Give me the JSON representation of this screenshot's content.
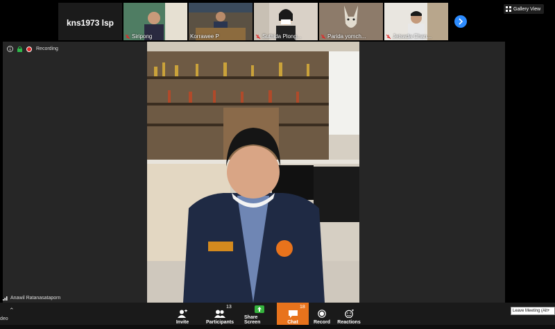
{
  "thumbnails": [
    {
      "name": "",
      "label": "kns1973 lsp",
      "kind": "text"
    },
    {
      "name": "Siripong",
      "bg": "#5a8c6e"
    },
    {
      "name": "Korrawee P",
      "bg": "#6b6154"
    },
    {
      "name": "Suthida Plong...",
      "bg": "#d9d1c7"
    },
    {
      "name": "Parida yomch...",
      "bg": "#8d7b6a"
    },
    {
      "name": "Jetsada Chan...",
      "bg": "#7a6c5c"
    }
  ],
  "gallery_view_label": "Gallery View",
  "recording_label": "Recording",
  "speaker_name": "Anawil Ratanasataporn",
  "toolbar": {
    "left_label": "deo",
    "buttons": [
      {
        "id": "invite",
        "label": "Invite"
      },
      {
        "id": "participants",
        "label": "Participants",
        "count": "13"
      },
      {
        "id": "share",
        "label": "Share Screen"
      },
      {
        "id": "chat",
        "label": "Chat",
        "count": "18"
      },
      {
        "id": "record",
        "label": "Record"
      },
      {
        "id": "reactions",
        "label": "Reactions"
      }
    ],
    "leave_tooltip": "Leave Meeting (Alt+"
  },
  "colors": {
    "share_green": "#35b33d",
    "chat_orange": "#e8731c",
    "recording_red": "#e02828",
    "arrow_blue": "#2d8cff"
  }
}
